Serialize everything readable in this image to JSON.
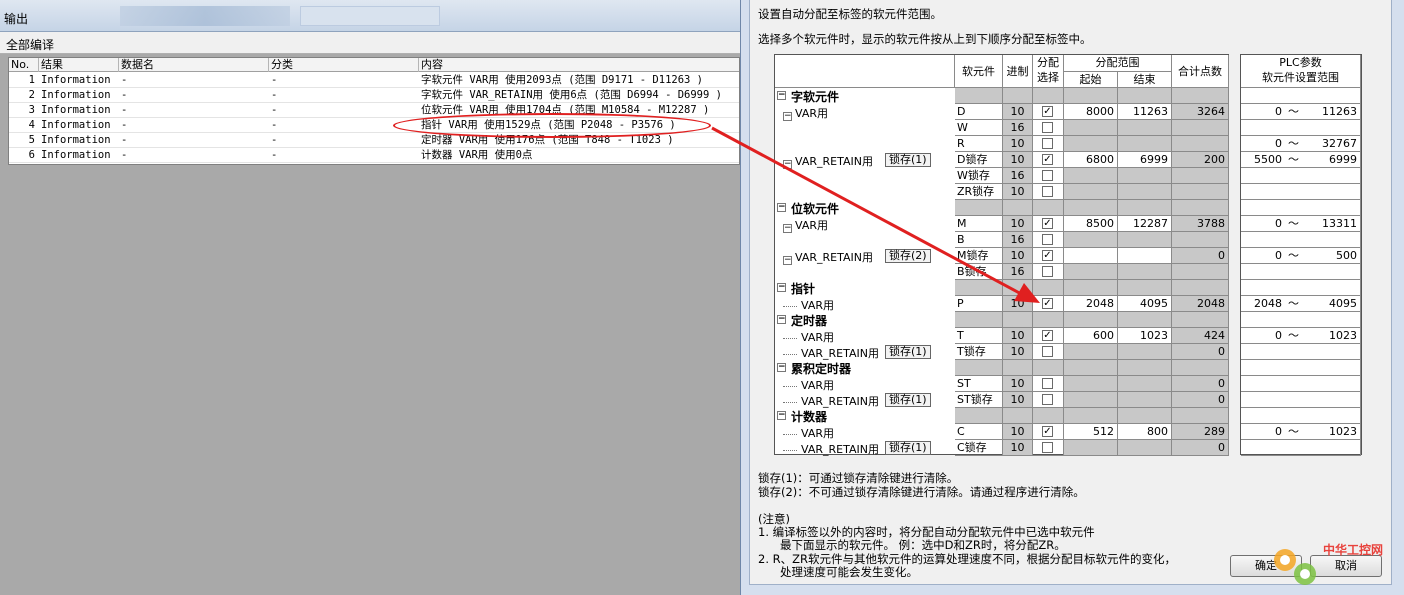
{
  "output": {
    "title": "输出",
    "subtitle": "全部编译",
    "columns": [
      "No.",
      "结果",
      "数据名",
      "分类",
      "内容"
    ],
    "rows": [
      {
        "no": "1",
        "result": "Information",
        "data": "-",
        "cat": "-",
        "content": "字软元件 VAR用 使用2093点 (范围 D9171 - D11263 )"
      },
      {
        "no": "2",
        "result": "Information",
        "data": "-",
        "cat": "-",
        "content": "字软元件 VAR_RETAIN用 使用6点 (范围 D6994 - D6999 )"
      },
      {
        "no": "3",
        "result": "Information",
        "data": "-",
        "cat": "-",
        "content": "位软元件 VAR用 使用1704点 (范围 M10584 - M12287 )"
      },
      {
        "no": "4",
        "result": "Information",
        "data": "-",
        "cat": "-",
        "content": "指针 VAR用 使用1529点 (范围 P2048 - P3576 )"
      },
      {
        "no": "5",
        "result": "Information",
        "data": "-",
        "cat": "-",
        "content": "定时器 VAR用 使用176点 (范围 T848 - T1023 )"
      },
      {
        "no": "6",
        "result": "Information",
        "data": "-",
        "cat": "-",
        "content": "计数器 VAR用 使用0点"
      }
    ]
  },
  "dialog": {
    "line1": "设置自动分配至标签的软元件范围。",
    "line2": "选择多个软元件时，显示的软元件按从上到下顺序分配至标签中。",
    "headers": {
      "device": "软元件",
      "base": "进制",
      "alloc1": "分配",
      "alloc2": "选择",
      "range": "分配范围",
      "start": "起始",
      "end": "结束",
      "total": "合计点数",
      "plc1": "PLC参数",
      "plc2": "软元件设置范围"
    },
    "sections": {
      "word": "字软元件",
      "bit": "位软元件",
      "pointer": "指针",
      "timer": "定时器",
      "acc_timer": "累积定时器",
      "counter": "计数器"
    },
    "labels": {
      "var": "VAR用",
      "retain": "VAR_RETAIN用",
      "lock1": "锁存(1)",
      "lock2": "锁存(2)",
      "tilde": "～"
    },
    "rows": [
      {
        "dev": "D",
        "base": "10",
        "chk": true,
        "start": "8000",
        "end": "11263",
        "total": "3264",
        "plc_from": "0",
        "plc_to": "11263"
      },
      {
        "dev": "W",
        "base": "16",
        "chk": false,
        "start": "",
        "end": "",
        "total": "",
        "plc_from": "",
        "plc_to": ""
      },
      {
        "dev": "R",
        "base": "10",
        "chk": false,
        "start": "",
        "end": "",
        "total": "",
        "plc_from": "0",
        "plc_to": "32767"
      },
      {
        "dev": "D锁存",
        "base": "10",
        "chk": true,
        "start": "6800",
        "end": "6999",
        "total": "200",
        "plc_from": "5500",
        "plc_to": "6999"
      },
      {
        "dev": "W锁存",
        "base": "16",
        "chk": false,
        "start": "",
        "end": "",
        "total": "",
        "plc_from": "",
        "plc_to": ""
      },
      {
        "dev": "ZR锁存",
        "base": "10",
        "chk": false,
        "start": "",
        "end": "",
        "total": "",
        "plc_from": "",
        "plc_to": ""
      },
      {
        "dev": "M",
        "base": "10",
        "chk": true,
        "start": "8500",
        "end": "12287",
        "total": "3788",
        "plc_from": "0",
        "plc_to": "13311"
      },
      {
        "dev": "B",
        "base": "16",
        "chk": false,
        "start": "",
        "end": "",
        "total": "",
        "plc_from": "",
        "plc_to": ""
      },
      {
        "dev": "M锁存",
        "base": "10",
        "chk": true,
        "start": "",
        "end": "",
        "total": "0",
        "plc_from": "0",
        "plc_to": "500"
      },
      {
        "dev": "B锁存",
        "base": "16",
        "chk": false,
        "start": "",
        "end": "",
        "total": "",
        "plc_from": "",
        "plc_to": ""
      },
      {
        "dev": "P",
        "base": "10",
        "chk": true,
        "start": "2048",
        "end": "4095",
        "total": "2048",
        "plc_from": "2048",
        "plc_to": "4095"
      },
      {
        "dev": "T",
        "base": "10",
        "chk": true,
        "start": "600",
        "end": "1023",
        "total": "424",
        "plc_from": "0",
        "plc_to": "1023"
      },
      {
        "dev": "T锁存",
        "base": "10",
        "chk": false,
        "start": "",
        "end": "",
        "total": "0",
        "plc_from": "",
        "plc_to": ""
      },
      {
        "dev": "ST",
        "base": "10",
        "chk": false,
        "start": "",
        "end": "",
        "total": "0",
        "plc_from": "",
        "plc_to": ""
      },
      {
        "dev": "ST锁存",
        "base": "10",
        "chk": false,
        "start": "",
        "end": "",
        "total": "0",
        "plc_from": "",
        "plc_to": ""
      },
      {
        "dev": "C",
        "base": "10",
        "chk": true,
        "start": "512",
        "end": "800",
        "total": "289",
        "plc_from": "0",
        "plc_to": "1023"
      },
      {
        "dev": "C锁存",
        "base": "10",
        "chk": false,
        "start": "",
        "end": "",
        "total": "0",
        "plc_from": "",
        "plc_to": ""
      }
    ],
    "note1": "锁存(1)：可通过锁存清除键进行清除。",
    "note2": "锁存(2)：不可通过锁存清除键进行清除。请通过程序进行清除。",
    "note_title": "(注意)",
    "note3a": "1.    编译标签以外的内容时，将分配自动分配软元件中已选中软元件",
    "note3b": "最下面显示的软元件。   例：选中D和ZR时，将分配ZR。",
    "note4a": "2.    R、ZR软元件与其他软元件的运算处理速度不同，根据分配目标软元件的变化，",
    "note4b": "处理速度可能会发生变化。",
    "ok": "确定",
    "cancel": "取消"
  },
  "watermark": "中华工控网",
  "colors": {
    "annotation": "#e02020",
    "section_gray": "#c8c8c8"
  }
}
